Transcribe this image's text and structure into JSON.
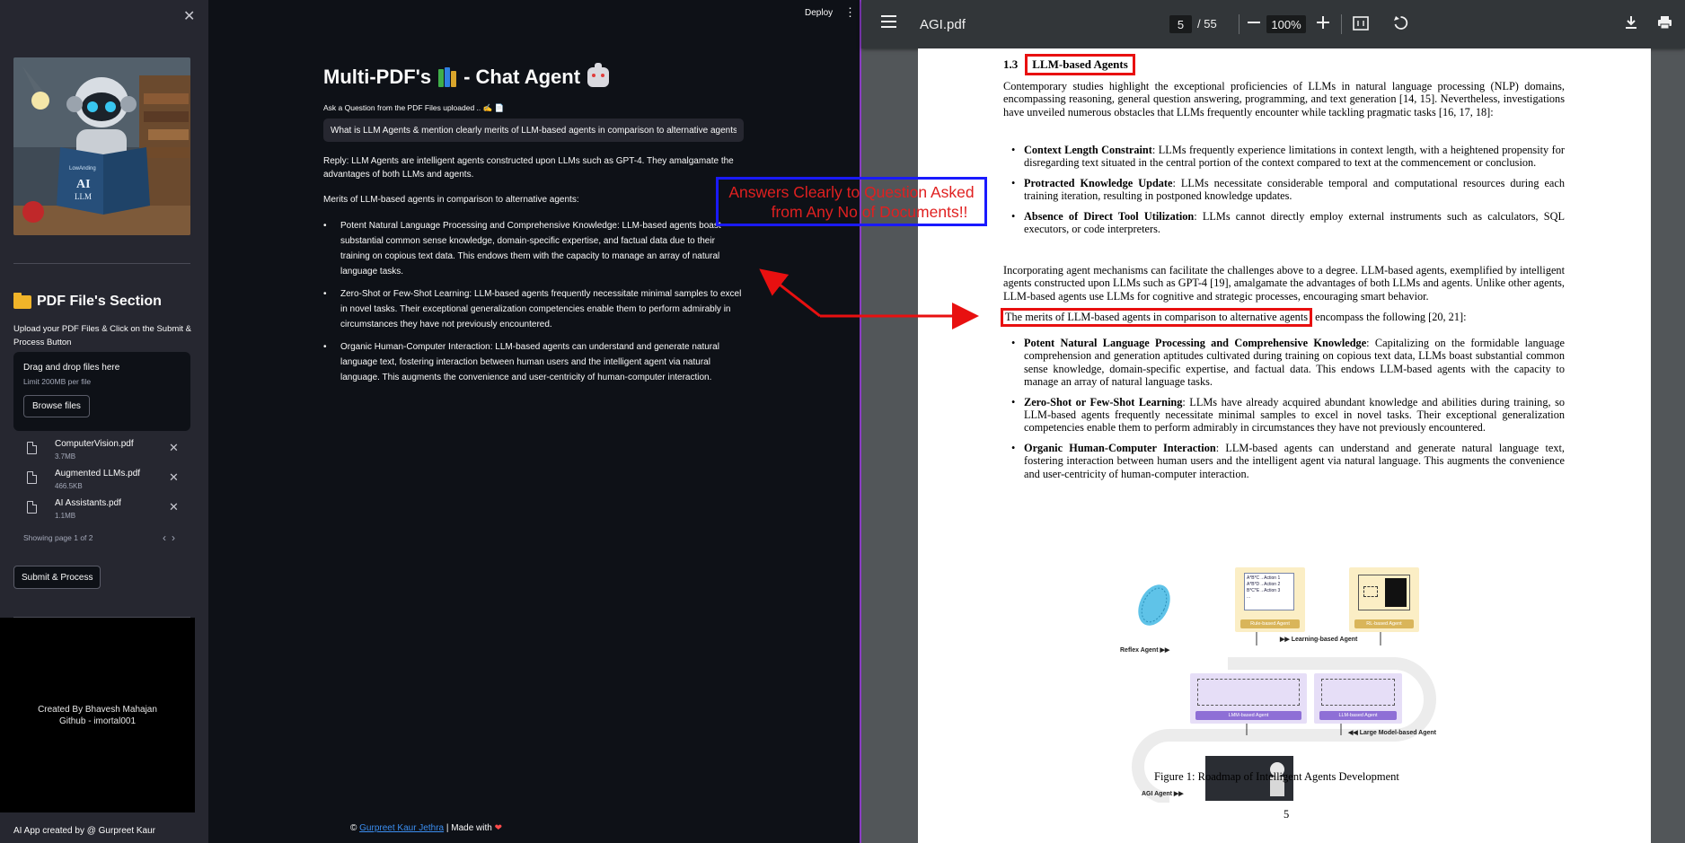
{
  "sidebar": {
    "close_glyph": "✕",
    "files_section_title": "PDF File's Section",
    "upload_instructions": "Upload your PDF Files & Click on the Submit & Process Button",
    "dropzone_title": "Drag and drop files here",
    "dropzone_limit": "Limit 200MB per file",
    "browse_label": "Browse files",
    "files": [
      {
        "name": "ComputerVision.pdf",
        "size": "3.7MB"
      },
      {
        "name": "Augmented LLMs.pdf",
        "size": "466.5KB"
      },
      {
        "name": "AI Assistants.pdf",
        "size": "1.1MB"
      }
    ],
    "pager_text": "Showing page 1 of 2",
    "pager_prev": "‹",
    "pager_next": "›",
    "submit_label": "Submit & Process",
    "credit_line1": "Created By Bhavesh Mahajan",
    "credit_line2": "Github - imortal001",
    "app_credit": "AI App created by @ Gurpreet Kaur",
    "robot_book_line1": "LowAnding",
    "robot_book_line2": "AI",
    "robot_book_line3": "LLM"
  },
  "header": {
    "deploy_label": "Deploy",
    "menu_glyph": "⋮"
  },
  "chat": {
    "title_prefix": "Multi-PDF's",
    "title_suffix": "- Chat Agent",
    "ask_label": "Ask a Question from the PDF Files uploaded .. ✍️ 📄",
    "question": "What is LLM Agents & mention clearly merits of LLM-based agents in comparison to alternative agents?",
    "reply": "Reply: LLM Agents are intelligent agents constructed upon LLMs such as GPT-4. They amalgamate the advantages of both LLMs and agents.",
    "merits_heading": "Merits of LLM-based agents in comparison to alternative agents:",
    "merits": [
      "Potent Natural Language Processing and Comprehensive Knowledge: LLM-based agents boast substantial common sense knowledge, domain-specific expertise, and factual data due to their training on copious text data. This endows them with the capacity to manage an array of natural language tasks.",
      "Zero-Shot or Few-Shot Learning: LLM-based agents frequently necessitate minimal samples to excel in novel tasks. Their exceptional generalization competencies enable them to perform admirably in circumstances they have not previously encountered.",
      "Organic Human-Computer Interaction: LLM-based agents can understand and generate natural language text, fostering interaction between human users and the intelligent agent via natural language. This augments the convenience and user-centricity of human-computer interaction."
    ],
    "footer_prefix": "© ",
    "footer_link": "Gurpreet Kaur Jethra",
    "footer_suffix": " | Made with "
  },
  "annotation": {
    "line1": "Answers Clearly to Question Asked",
    "line2": "from Any No of Documents!!",
    "box_color": "#1a1aff",
    "text_color": "#e02020"
  },
  "pdf": {
    "file_name": "AGI.pdf",
    "current_page": "5",
    "total_pages": "/ 55",
    "zoom": "100%",
    "section_number": "1.3",
    "section_title": "LLM-based Agents",
    "intro": "Contemporary studies highlight the exceptional proficiencies of LLMs in natural language processing (NLP) domains, encompassing reasoning, general question answering, programming, and text generation [14, 15]. Nevertheless, investigations have unveiled numerous obstacles that LLMs frequently encounter while tackling pragmatic tasks [16, 17, 18]:",
    "obstacles": [
      {
        "bold": "Context Length Constraint",
        "text": ": LLMs frequently experience limitations in context length, with a heightened propensity for disregarding text situated in the central portion of the context compared to text at the commencement or conclusion."
      },
      {
        "bold": "Protracted Knowledge Update",
        "text": ": LLMs necessitate considerable temporal and computational resources during each training iteration, resulting in postponed knowledge updates."
      },
      {
        "bold": "Absence of Direct Tool Utilization",
        "text": ": LLMs cannot directly employ external instruments such as calculators, SQL executors, or code interpreters."
      }
    ],
    "mechanism_para": "Incorporating agent mechanisms can facilitate the challenges above to a degree. LLM-based agents, exemplified by intelligent agents constructed upon LLMs such as GPT-4 [19], amalgamate the advantages of both LLMs and agents. Unlike other agents, LLM-based agents use LLMs for cognitive and strategic processes, encouraging smart behavior.",
    "merits_boxed": "The merits of LLM-based agents in comparison to alternative agents",
    "merits_rest": " encompass the following [20, 21]:",
    "merits": [
      {
        "bold": "Potent Natural Language Processing and Comprehensive Knowledge",
        "text": ": Capitalizing on the formidable language comprehension and generation aptitudes cultivated during training on copious text data, LLMs boast substantial common sense knowledge, domain-specific expertise, and factual data. This endows LLM-based agents with the capacity to manage an array of natural language tasks."
      },
      {
        "bold": "Zero-Shot or Few-Shot Learning",
        "text": ": LLMs have already acquired abundant knowledge and abilities during training, so LLM-based agents frequently necessitate minimal samples to excel in novel tasks. Their exceptional generalization competencies enable them to perform admirably in circumstances they have not previously encountered."
      },
      {
        "bold": "Organic Human-Computer Interaction",
        "text": ": LLM-based agents can understand and generate natural language text, fostering interaction between human users and the intelligent agent via natural language. This augments the convenience and user-centricity of human-computer interaction."
      }
    ],
    "figure": {
      "rule_card_lines": [
        "A*B*C→Action 1",
        "A*B*D→Action 2",
        "B*C*E→Action 3",
        "..."
      ],
      "rule_tag": "Rule-based Agent",
      "rl_tag": "RL-based Agent",
      "lmm_tag": "LMM-based Agent",
      "llm_tag": "LLM-based Agent",
      "reflex_label": "Reflex Agent ▶▶",
      "learning_label": "▶▶ Learning-based Agent",
      "large_model_label": "◀◀ Large Model-based Agent",
      "agi_label": "AGI Agent ▶▶"
    },
    "figure_caption": "Figure 1: Roadmap of Intelligent Agents Development",
    "page_number": "5"
  },
  "colors": {
    "app_bg": "#0e1117",
    "sidebar_bg": "#262730",
    "pdf_toolbar": "#323639",
    "pdf_bg": "#525659",
    "highlight_red": "#e81010",
    "link_blue": "#3b8ef0"
  }
}
